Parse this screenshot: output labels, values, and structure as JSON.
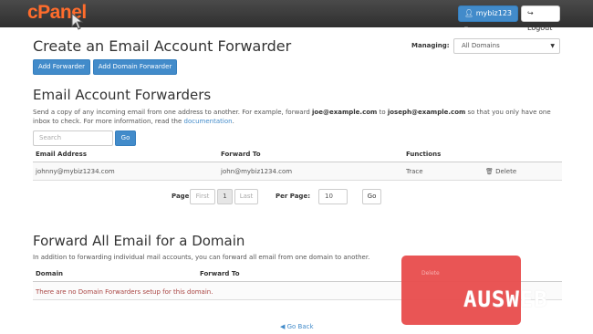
{
  "header": {
    "logo_text": "cPanel",
    "user_label": "mybiz123",
    "logout_label": "Logout"
  },
  "page_title": "Create an Email Account Forwarder",
  "buttons": {
    "add_forwarder": "Add Forwarder",
    "add_domain_forwarder": "Add Domain Forwarder"
  },
  "managing": {
    "label": "Managing:",
    "selected": "All Domains"
  },
  "email_forwarders": {
    "title": "Email Account Forwarders",
    "desc_part1": "Send a copy of any incoming email from one address to another. For example, forward ",
    "desc_b1": "joe@example.com",
    "desc_part2": " to ",
    "desc_b2": "joseph@example.com",
    "desc_part3": " so that you only have one inbox to check. For more information, read the ",
    "desc_link": "documentation",
    "desc_end": ".",
    "search_placeholder": "Search",
    "go_label": "Go",
    "columns": [
      "Email Address",
      "Forward To",
      "Functions"
    ],
    "rows": [
      {
        "email": "johnny@mybiz1234.com",
        "forward_to": "john@mybiz1234.com",
        "trace": "Trace",
        "delete": "Delete"
      }
    ],
    "pager": {
      "page_label": "Page:",
      "first": "First",
      "current": "1",
      "last": "Last",
      "per_page_label": "Per Page:",
      "per_page_value": "10",
      "go": "Go"
    }
  },
  "domain_forwarders": {
    "title": "Forward All Email for a Domain",
    "desc": "In addition to forwarding individual mail accounts, you can forward all email from one domain to another.",
    "columns": [
      "Domain",
      "Forward To",
      "Delete"
    ],
    "empty_message": "There are no Domain Forwarders setup for this domain."
  },
  "go_back": "Go Back",
  "watermark": "AUSWEB"
}
